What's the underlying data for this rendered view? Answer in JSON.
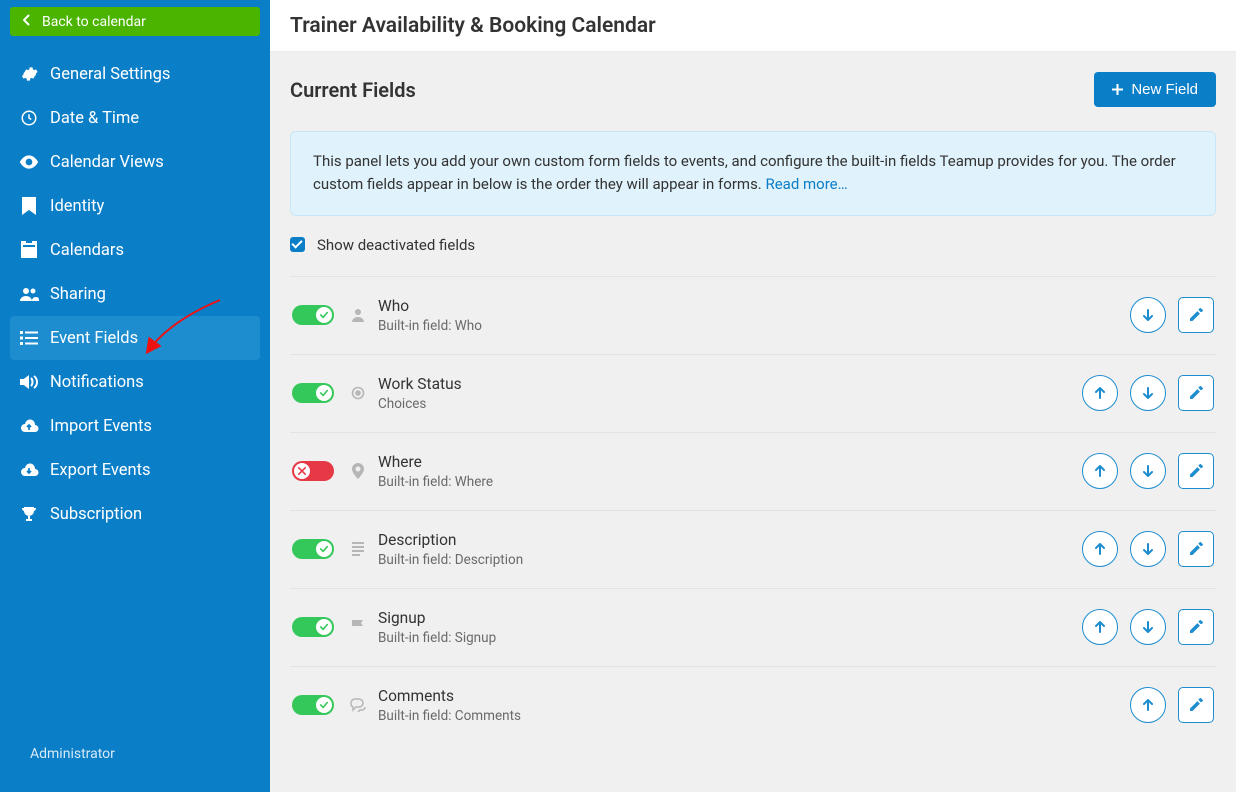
{
  "back_label": "Back to calendar",
  "page_title": "Trainer Availability & Booking Calendar",
  "nav": [
    {
      "icon": "gear",
      "label": "General Settings"
    },
    {
      "icon": "clock",
      "label": "Date & Time"
    },
    {
      "icon": "eye",
      "label": "Calendar Views"
    },
    {
      "icon": "bookmark",
      "label": "Identity"
    },
    {
      "icon": "calendar",
      "label": "Calendars"
    },
    {
      "icon": "people",
      "label": "Sharing"
    },
    {
      "icon": "list",
      "label": "Event Fields",
      "active": true
    },
    {
      "icon": "sound",
      "label": "Notifications"
    },
    {
      "icon": "cloud-up",
      "label": "Import Events"
    },
    {
      "icon": "cloud-down",
      "label": "Export Events"
    },
    {
      "icon": "trophy",
      "label": "Subscription"
    }
  ],
  "admin_label": "Administrator",
  "section_title": "Current Fields",
  "new_field_label": "New Field",
  "info_text": "This panel lets you add your own custom form fields to events, and configure the built-in fields Teamup provides for you. The order custom fields appear in below is the order they will appear in forms. ",
  "read_more": "Read more…",
  "show_deactivated": "Show deactivated fields",
  "fields": [
    {
      "name": "Who",
      "subtitle": "Built-in field: Who",
      "enabled": true,
      "icon": "person",
      "up": false,
      "down": true,
      "edit": true
    },
    {
      "name": "Work Status",
      "subtitle": "Choices",
      "enabled": true,
      "icon": "radio",
      "up": true,
      "down": true,
      "edit": true
    },
    {
      "name": "Where",
      "subtitle": "Built-in field: Where",
      "enabled": false,
      "icon": "pin",
      "up": true,
      "down": true,
      "edit": true
    },
    {
      "name": "Description",
      "subtitle": "Built-in field: Description",
      "enabled": true,
      "icon": "lines",
      "up": true,
      "down": true,
      "edit": true
    },
    {
      "name": "Signup",
      "subtitle": "Built-in field: Signup",
      "enabled": true,
      "icon": "flag",
      "up": true,
      "down": true,
      "edit": true
    },
    {
      "name": "Comments",
      "subtitle": "Built-in field: Comments",
      "enabled": true,
      "icon": "chat",
      "up": true,
      "down": false,
      "edit": true
    }
  ]
}
